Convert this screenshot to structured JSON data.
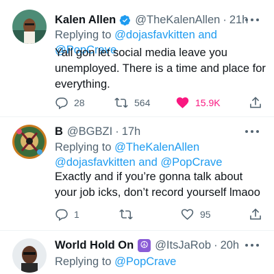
{
  "tweets": [
    {
      "display_name": "Kalen Allen",
      "verified": true,
      "handle": "@TheKalenAllen",
      "separator": "·",
      "time": "21h",
      "replying_prefix": "Replying to ",
      "replying_line1": "@dojasfavkitten and @PopCrave",
      "replying_line2": "",
      "text": "Yall gon let social media leave you unemployed. There is a time and place for everything.",
      "replies": "28",
      "retweets": "564",
      "likes": "15.9K",
      "liked": true
    },
    {
      "display_name": "B",
      "verified": false,
      "handle": "@BGBZI",
      "separator": "·",
      "time": "17h",
      "replying_prefix": "Replying to ",
      "replying_line1": "@TheKalenAllen",
      "replying_line2": "@dojasfavkitten and @PopCrave",
      "text": "Exactly and if you’re gonna talk  about your job icks, don’t record yourself lmaoo",
      "replies": "1",
      "retweets": "",
      "likes": "95",
      "liked": false
    },
    {
      "display_name": "World Hold On",
      "emoji": "☮",
      "verified": false,
      "handle": "@ItsJaRob",
      "separator": "·",
      "time": "20h",
      "replying_prefix": "Replying to ",
      "replying_line1": "@PopCrave",
      "replying_line2": ""
    }
  ],
  "icons": {
    "reply": "reply-icon",
    "retweet": "retweet-icon",
    "like": "heart-icon",
    "share": "share-icon",
    "more": "more-icon",
    "verified": "verified-badge-icon"
  },
  "colors": {
    "accent": "#1d9bf0",
    "like": "#f91880",
    "muted": "#536471",
    "text": "#0f1419",
    "peace_bg": "#8a5cd6"
  }
}
